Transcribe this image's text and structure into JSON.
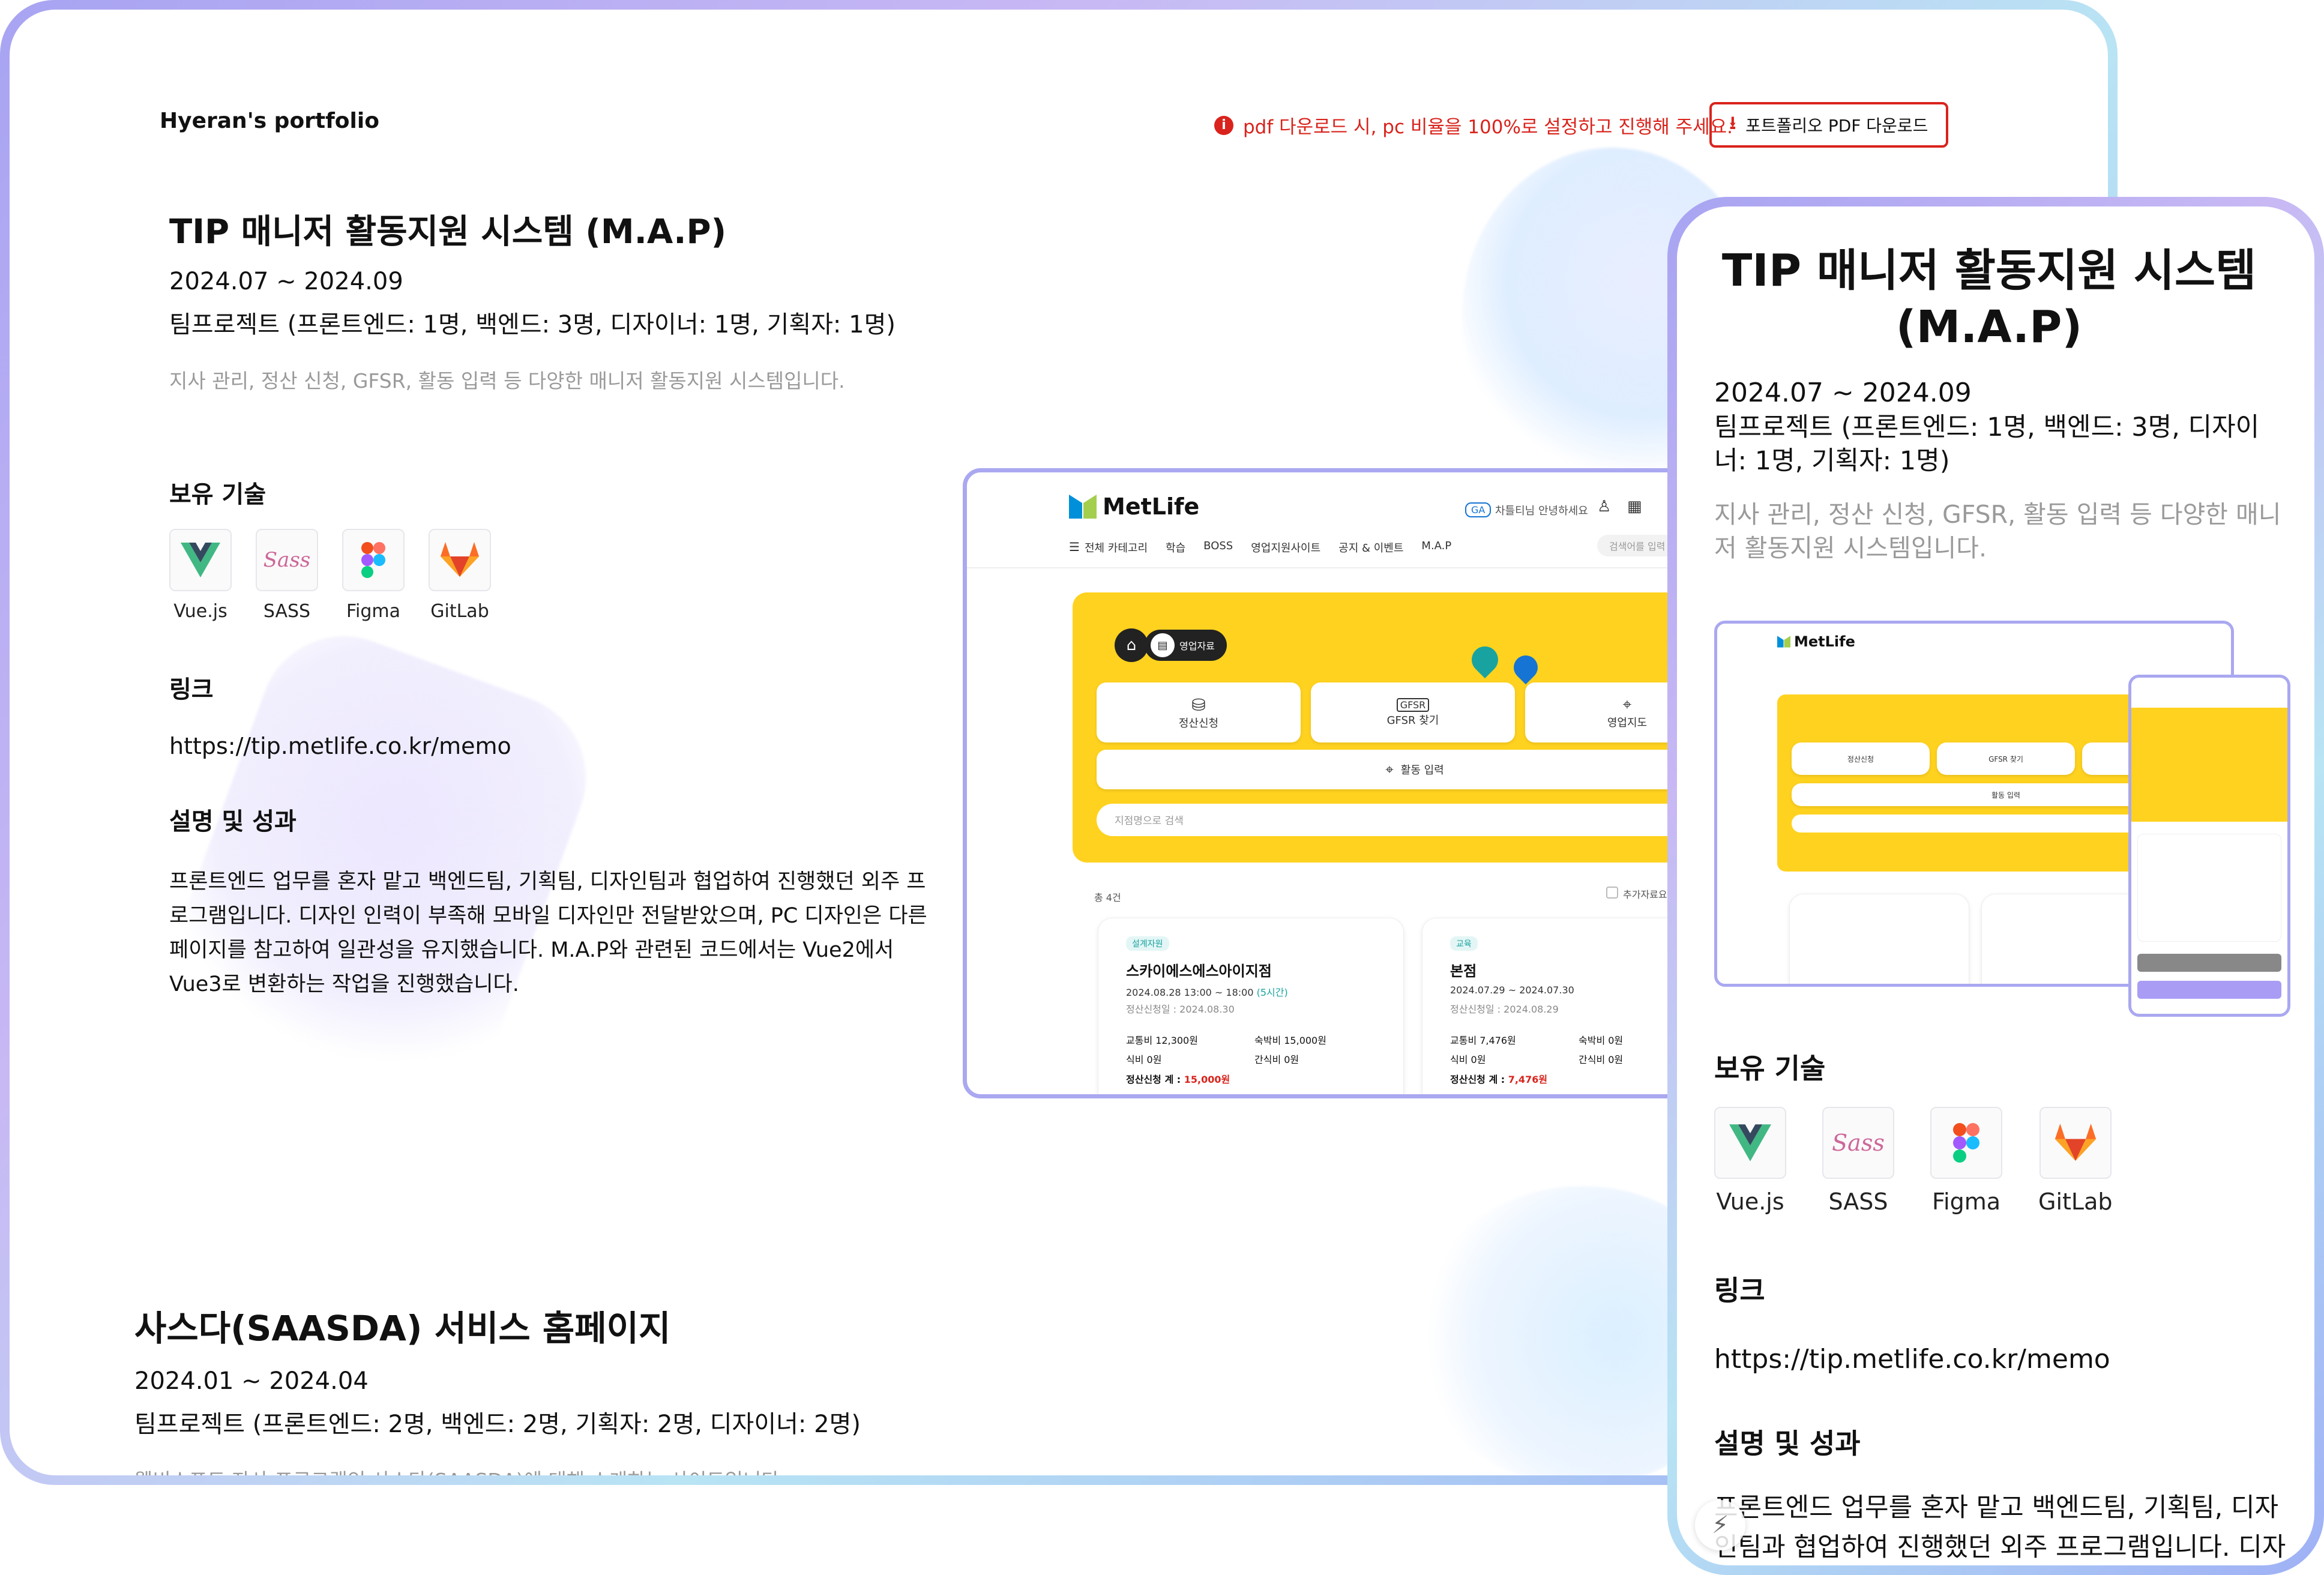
{
  "header": {
    "portfolio_title": "Hyeran's portfolio",
    "notice": "pdf 다운로드 시, pc 비율을 100%로 설정하고 진행해 주세요.",
    "download_label": "포트폴리오 PDF 다운로드"
  },
  "project1": {
    "title": "TIP 매니저 활동지원 시스템 (M.A.P)",
    "period": "2024.07 ~ 2024.09",
    "team": "팀프로젝트 (프론트엔드: 1명, 백엔드: 3명, 디자이너: 1명, 기획자: 1명)",
    "summary": "지사 관리, 정산 신청, GFSR, 활동 입력 등 다양한 매니저 활동지원 시스템입니다.",
    "skills_heading": "보유 기술",
    "skills": [
      "Vue.js",
      "SASS",
      "Figma",
      "GitLab"
    ],
    "link_heading": "링크",
    "link": "https://tip.metlife.co.kr/memo",
    "desc_heading": "설명 및 성과",
    "desc": "프론트엔드 업무를 혼자 맡고 백엔드팀, 기획팀, 디자인팀과 협업하여 진행했던 외주 프로그램입니다. 디자인 인력이 부족해 모바일 디자인만 전달받았으며, PC 디자인은 다른 페이지를 참고하여 일관성을 유지했습니다. M.A.P와 관련된 코드에서는 Vue2에서 Vue3로 변환하는 작업을 진행했습니다."
  },
  "project2": {
    "title": "사스다(SAASDA) 서비스 홈페이지",
    "period": "2024.01 ~ 2024.04",
    "team": "팀프로젝트 (프론트엔드: 2명, 백엔드: 2명, 기획자: 2명, 디자이너: 2명)",
    "summary": "웹비소프트 자사 프로그램인 사스다(SAASDA)에 대해 소개하는 사이트입니다."
  },
  "mobile": {
    "title": "TIP 매니저 활동지원 시스템 (M.A.P)",
    "period": "2024.07 ~ 2024.09",
    "team": "팀프로젝트 (프론트엔드: 1명, 백엔드: 3명, 디자이너: 1명, 기획자: 1명)",
    "summary": "지사 관리, 정산 신청, GFSR, 활동 입력 등 다양한 매니저 활동지원 시스템입니다.",
    "skills_heading": "보유 기술",
    "link_heading": "링크",
    "link": "https://tip.metlife.co.kr/memo",
    "desc_heading": "설명 및 성과",
    "desc": "프론트엔드 업무를 혼자 맡고 백엔드팀, 기획팀, 디자인팀과 협업하여 진행했던 외주 프로그램입니다. 디자인 인력이 부족해 모바일 디자인만 전달받았으며, PC 디자인"
  },
  "metlife": {
    "logo": "MetLife",
    "greeting": "차틀티님 안녕하세요",
    "badge": "GA",
    "search_placeholder": "검색어를 입력",
    "nav": [
      "전체 카테고리",
      "학습",
      "BOSS",
      "영업지원사이트",
      "공지 & 이벤트",
      "M.A.P"
    ],
    "chip": "영업자료",
    "tiles": [
      "정산신청",
      "GFSR 찾기",
      "영업지도"
    ],
    "activity": "활동 입력",
    "branch_search": "지점명으로 검색",
    "count": "총 4건",
    "add_label": "추가자료요",
    "cards": [
      {
        "tag": "설계자원",
        "name": "스카이에스에스아이지점",
        "date": "2024.08.28 13:00 ~ 18:00",
        "hours": "(5시간)",
        "apply": "정산신청일 : 2024.08.30",
        "c1": "교통비 12,300원",
        "c2": "숙박비 15,000원",
        "c3": "식비 0원",
        "c4": "간식비 0원",
        "total_label": "정산신청 계 :",
        "total": "15,000원"
      },
      {
        "tag": "교육",
        "name": "본점",
        "date": "2024.07.29 ~ 2024.07.30",
        "hours": "",
        "apply": "정산신청일 : 2024.08.29",
        "c1": "교통비 7,476원",
        "c2": "숙박비 0원",
        "c3": "식비 0원",
        "c4": "간식비 0원",
        "total_label": "정산신청 계 :",
        "total": "7,476원"
      }
    ]
  },
  "colors": {
    "accent_red": "#d9231c",
    "frame": "#a8a4f2",
    "yellow": "#ffd21f",
    "teal": "#18a3a1",
    "blue": "#1574d4"
  }
}
